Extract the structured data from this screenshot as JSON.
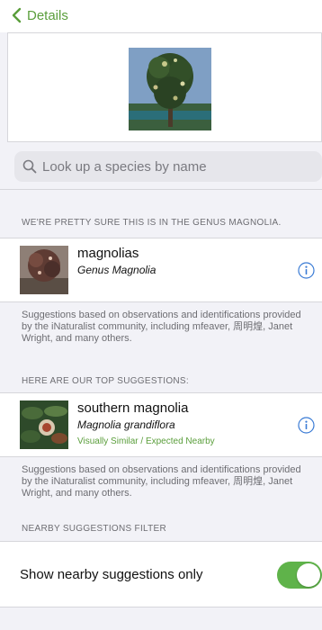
{
  "nav": {
    "back_label": "Details",
    "back_icon": "chevron-left-icon"
  },
  "photo": {
    "alt": "magnolia tree photo"
  },
  "search": {
    "placeholder": "Look up a species by name",
    "icon": "search-icon"
  },
  "genus_section": {
    "header": "WE'RE PRETTY SURE THIS IS IN THE GENUS MAGNOLIA.",
    "result": {
      "common_name": "magnolias",
      "scientific_name": "Genus Magnolia",
      "icon": "info-icon"
    },
    "footnote": "Suggestions based on observations and identifications provided by the iNaturalist community, including mfeaver, 周明煌, Janet Wright, and many others."
  },
  "top_section": {
    "header": "HERE ARE OUR TOP SUGGESTIONS:",
    "result": {
      "common_name": "southern magnolia",
      "scientific_name": "Magnolia grandiflora",
      "badge": "Visually Similar / Expected Nearby",
      "icon": "info-icon"
    },
    "footnote": "Suggestions based on observations and identifications provided by the iNaturalist community, including mfeaver, 周明煌, Janet Wright, and many others."
  },
  "filter_section": {
    "header": "NEARBY SUGGESTIONS FILTER",
    "toggle_label": "Show nearby suggestions only",
    "toggle_on": true
  },
  "colors": {
    "accent": "#5a9e3b",
    "switch_on": "#5fb34a",
    "background": "#f2f2f7"
  }
}
